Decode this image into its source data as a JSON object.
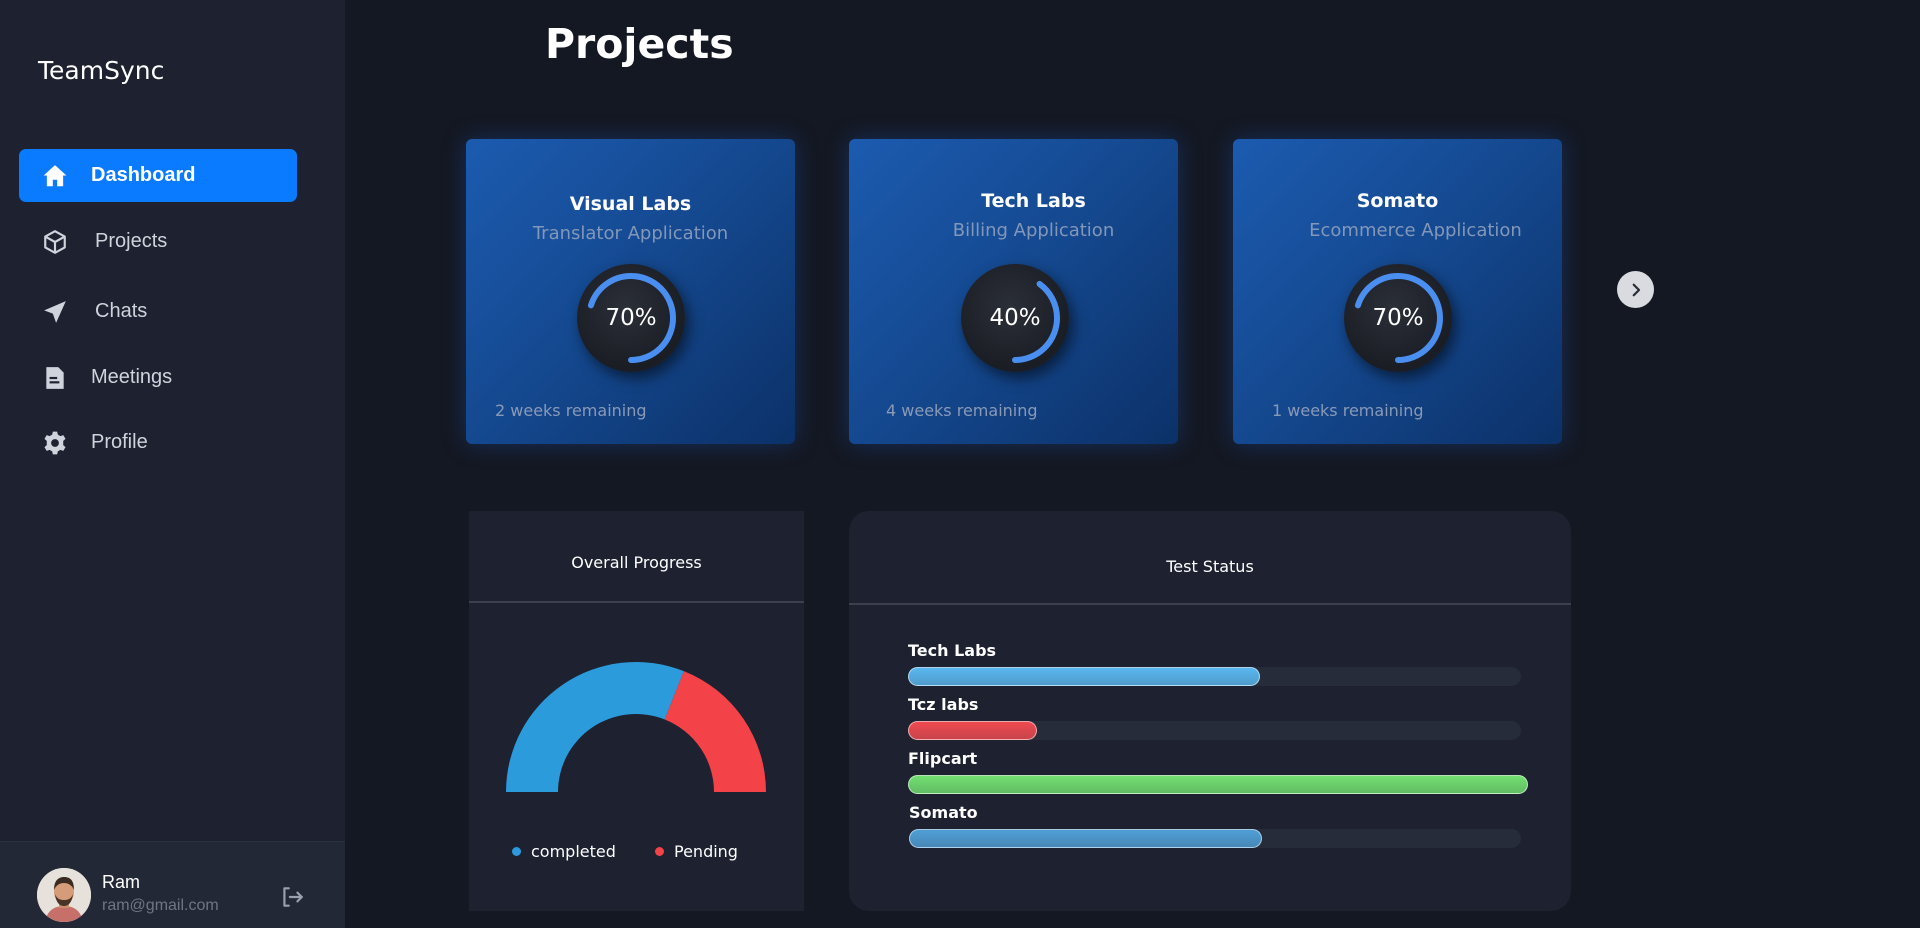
{
  "brand": "TeamSync",
  "nav": [
    {
      "label": "Dashboard",
      "icon": "home-icon",
      "active": true
    },
    {
      "label": "Projects",
      "icon": "cube-icon",
      "active": false
    },
    {
      "label": "Chats",
      "icon": "send-icon",
      "active": false
    },
    {
      "label": "Meetings",
      "icon": "document-icon",
      "active": false
    },
    {
      "label": "Profile",
      "icon": "gear-icon",
      "active": false
    }
  ],
  "user": {
    "name": "Ram",
    "email": "ram@gmail.com"
  },
  "page_title": "Projects",
  "projects": [
    {
      "name": "Visual Labs",
      "app": "Translator Application",
      "percent": 70,
      "percent_label": "70%",
      "remaining": "2 weeks remaining"
    },
    {
      "name": "Tech Labs",
      "app": "Billing Application",
      "percent": 40,
      "percent_label": "40%",
      "remaining": "4 weeks remaining"
    },
    {
      "name": "Somato",
      "app": "Ecommerce Application",
      "percent": 70,
      "percent_label": "70%",
      "remaining": "1 weeks remaining"
    }
  ],
  "overall_progress": {
    "title": "Overall Progress",
    "legend": [
      {
        "label": "completed",
        "color": "#2b9bdb"
      },
      {
        "label": "Pending",
        "color": "#f44249"
      }
    ]
  },
  "test_status": {
    "title": "Test Status",
    "bars": [
      {
        "label": "Tech Labs",
        "fraction": 0.575,
        "color": "#5ab8f0"
      },
      {
        "label": "Tcz labs",
        "fraction": 0.21,
        "color": "#f04a50"
      },
      {
        "label": "Flipcart",
        "fraction": 1.0,
        "color": "#72e070"
      },
      {
        "label": "Somato",
        "fraction": 0.577,
        "color": "#4f9fd6"
      }
    ]
  },
  "chart_data": {
    "type": "pie",
    "title": "Overall Progress",
    "categories": [
      "completed",
      "Pending"
    ],
    "values": [
      62,
      38
    ],
    "colors": [
      "#2b9bdb",
      "#f44249"
    ],
    "legend": "bottom"
  }
}
